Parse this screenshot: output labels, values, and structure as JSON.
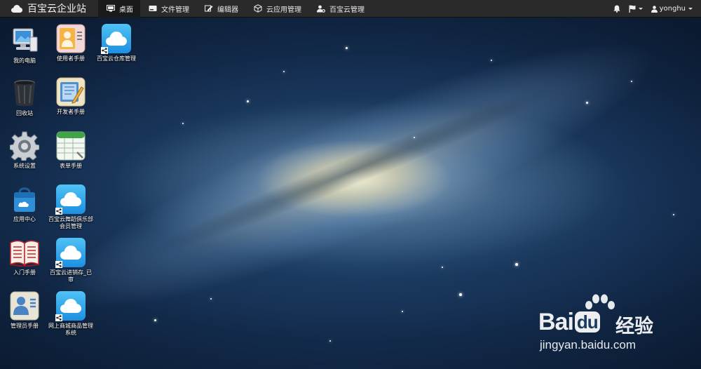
{
  "topbar": {
    "brand": "百宝云企业站",
    "nav": [
      {
        "label": "桌面",
        "icon": "monitor-icon",
        "active": true
      },
      {
        "label": "文件管理",
        "icon": "hdd-icon",
        "active": false
      },
      {
        "label": "编辑器",
        "icon": "edit-icon",
        "active": false
      },
      {
        "label": "云应用管理",
        "icon": "cube-icon",
        "active": false
      },
      {
        "label": "百宝云管理",
        "icon": "user-gear-icon",
        "active": false
      }
    ],
    "right": {
      "bell_icon": "bell-icon",
      "flag_icon": "flag-icon",
      "username": "yonghu"
    }
  },
  "desktop": {
    "icons": [
      {
        "label": "我的电脑",
        "icon": "computer-icon"
      },
      {
        "label": "回收站",
        "icon": "trash-icon"
      },
      {
        "label": "系统设置",
        "icon": "gear-icon"
      },
      {
        "label": "应用中心",
        "icon": "app-store-icon"
      },
      {
        "label": "入门手册",
        "icon": "book-icon"
      },
      {
        "label": "管理员手册",
        "icon": "admin-manual-icon"
      },
      {
        "label": "使用者手册",
        "icon": "user-manual-icon"
      },
      {
        "label": "开发者手册",
        "icon": "developer-manual-icon"
      },
      {
        "label": "表单手册",
        "icon": "spreadsheet-icon"
      },
      {
        "label": "百宝云舞蹈俱乐部会员管理",
        "icon": "cloud-app-icon"
      },
      {
        "label": "百宝云进销存_已审",
        "icon": "cloud-app-icon"
      },
      {
        "label": "网上商城商品管理系统",
        "icon": "cloud-app-icon"
      },
      {
        "label": "百宝云仓库管理",
        "icon": "cloud-app-icon"
      }
    ]
  },
  "watermark": {
    "brand": "Bai",
    "brand_suffix": "du",
    "cn": "经验",
    "url": "jingyan.baidu.com"
  },
  "colors": {
    "topbar_bg": "#2a2a2a",
    "cloud_tile": "#2aa3ea"
  }
}
